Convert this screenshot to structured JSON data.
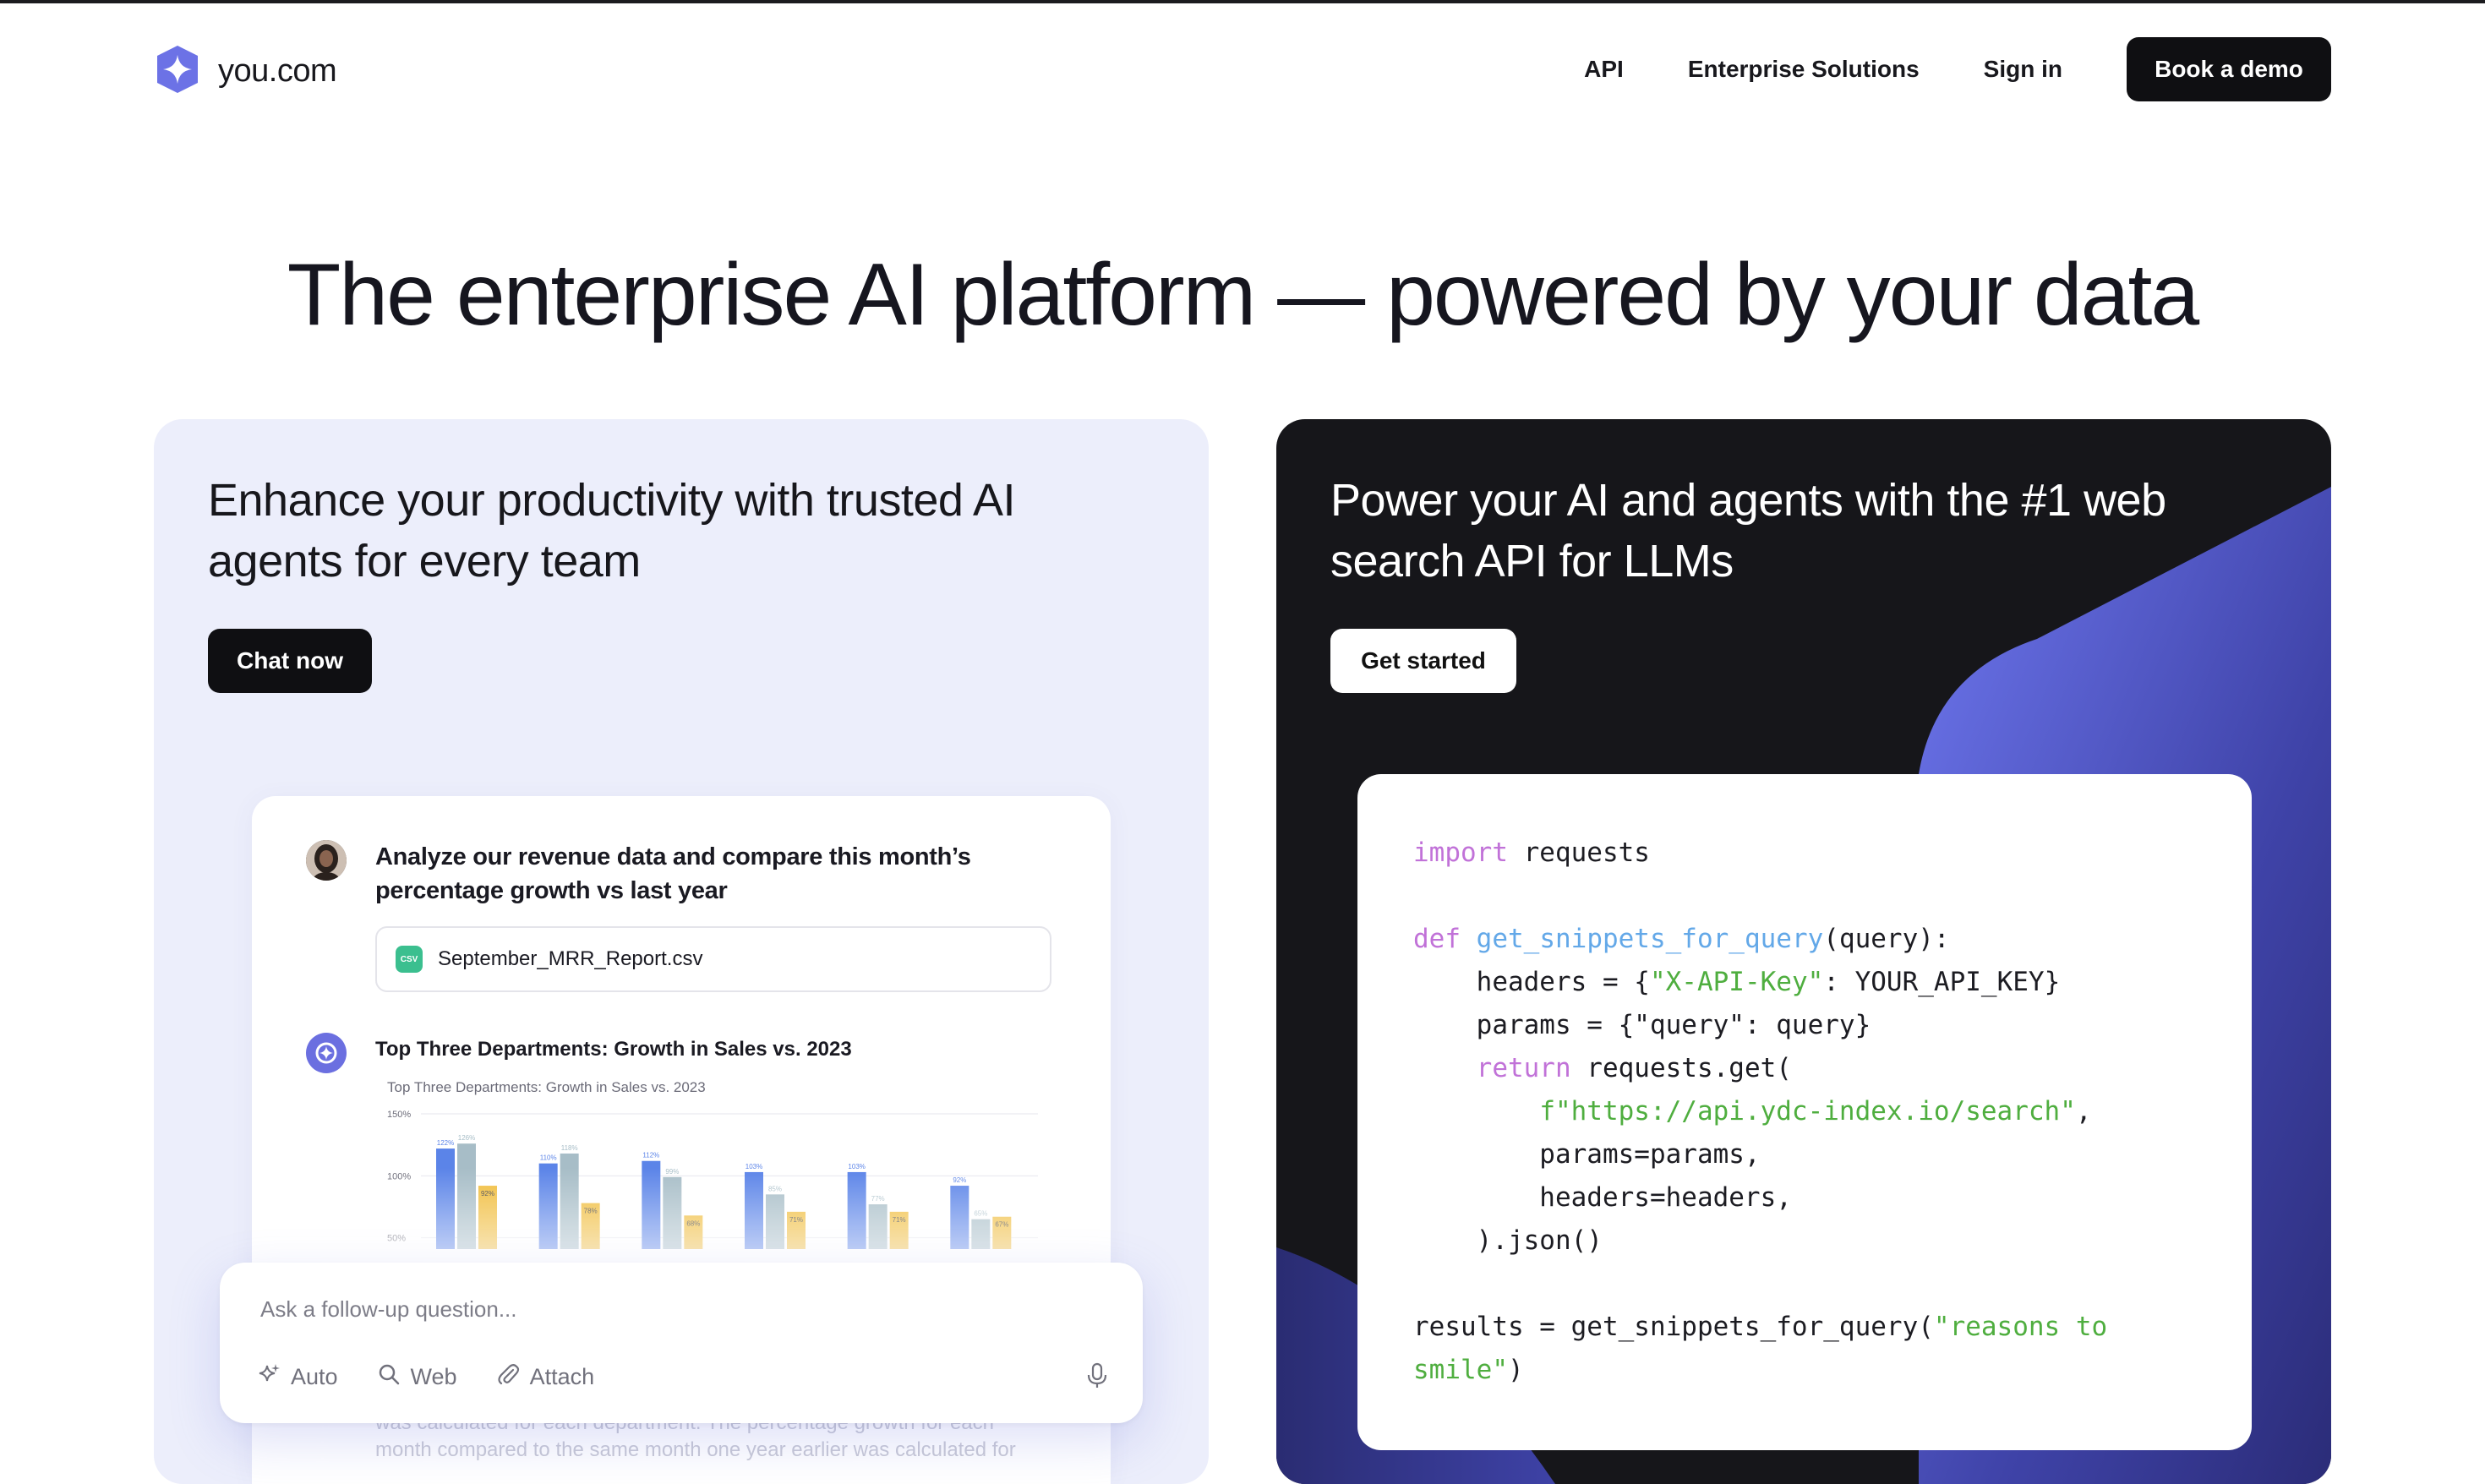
{
  "brand": {
    "name": "you.com"
  },
  "nav": {
    "links": [
      "API",
      "Enterprise Solutions",
      "Sign in"
    ],
    "cta": "Book a demo"
  },
  "hero": {
    "title": "The enterprise AI platform — powered by your data"
  },
  "left_card": {
    "title": "Enhance your productivity with trusted AI agents for every team",
    "cta": "Chat now",
    "chat": {
      "question": "Analyze our revenue data and compare this month’s percentage growth vs last year",
      "attachment": {
        "badge": "CSV",
        "name": "September_MRR_Report.csv"
      },
      "answer_title": "Top Three Departments: Growth in Sales vs. 2023",
      "faded_text": "was calculated for each department. The percentage growth for each month compared to the same month one year earlier was calculated for"
    },
    "followup": {
      "placeholder": "Ask a follow-up question...",
      "tools": [
        "Auto",
        "Web",
        "Attach"
      ]
    }
  },
  "right_card": {
    "title": "Power your AI and agents with the #1 web search API for LLMs",
    "cta": "Get started",
    "code": {
      "import_kw": "import",
      "import_rest": " requests",
      "def_kw": "def",
      "fn_name": "get_snippets_for_query",
      "fn_args": "(query):",
      "headers_a": "    headers = {",
      "headers_str": "\"X-API-Key\"",
      "headers_b": ": YOUR_API_KEY}",
      "params": "    params = {\"query\": query}",
      "return_indent": "    ",
      "return_kw": "return",
      "return_rest": " requests.get(",
      "url_indent": "        ",
      "url_str": "f\"https://api.ydc-index.io/search\"",
      "url_rest": ",",
      "params_kw": "        params=params,",
      "headers_kw": "        headers=headers,",
      "json": "    ).json()",
      "results_a": "results = get_snippets_for_query(",
      "results_str_1": "\"reasons to",
      "results_str_2": "smile\"",
      "results_b": ")"
    }
  },
  "chart_data": {
    "type": "bar",
    "title": "Top Three Departments: Growth in Sales vs. 2023",
    "ytick_labels": [
      "150%",
      "100%",
      "50%"
    ],
    "ylim": [
      0,
      150
    ],
    "categories": [
      "",
      "",
      "",
      "",
      "",
      ""
    ],
    "series": [
      {
        "color": "#5b84e8",
        "values": [
          122,
          110,
          112,
          103,
          103,
          92
        ]
      },
      {
        "color": "#a7bdc7",
        "values": [
          126,
          118,
          99,
          85,
          77,
          65
        ]
      },
      {
        "color": "#f0bc3a",
        "values": [
          92,
          78,
          68,
          71,
          71,
          67
        ]
      }
    ],
    "labels": [
      [
        "122%",
        "110%",
        "112%",
        "103%",
        "103%",
        "92%"
      ],
      [
        "126%",
        "118%",
        "99%",
        "85%",
        "77%",
        "65%"
      ],
      [
        "92%",
        "78%",
        "68%",
        "71%",
        "71%",
        "67%"
      ]
    ]
  }
}
